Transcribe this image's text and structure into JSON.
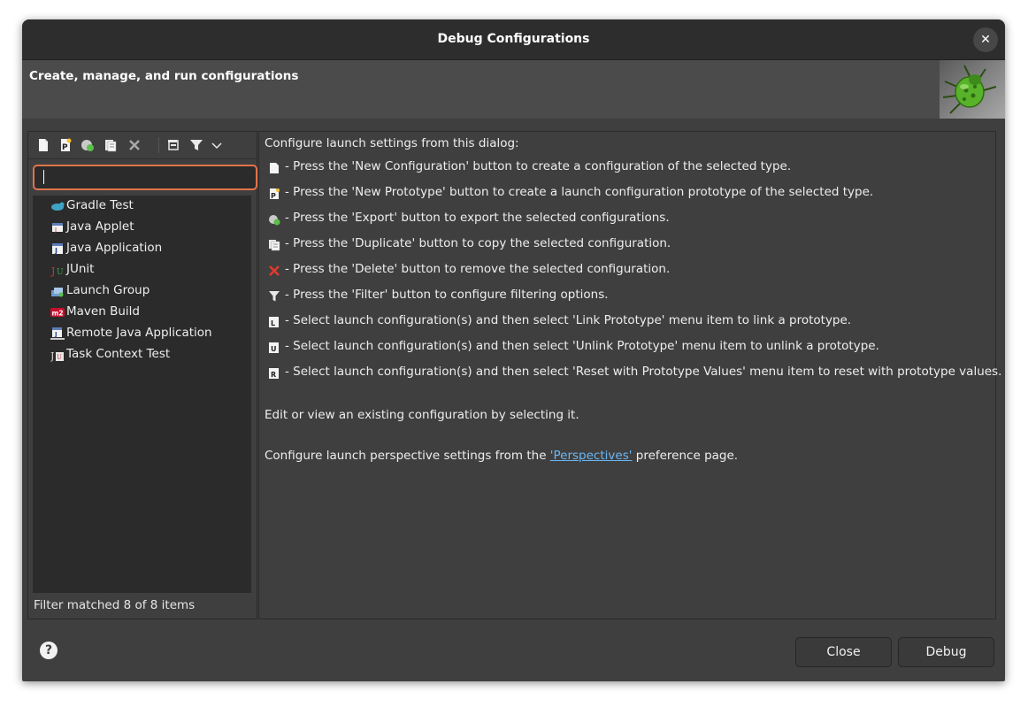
{
  "window": {
    "title": "Debug Configurations",
    "close_glyph": "✕"
  },
  "banner": {
    "text": "Create, manage, and run configurations",
    "icon": "debug-bug-icon"
  },
  "toolbar": {
    "buttons": [
      "new-configuration-icon",
      "new-prototype-icon",
      "export-icon",
      "duplicate-icon",
      "delete-icon",
      "collapse-all-icon",
      "filter-icon",
      "view-menu-chevron-icon"
    ]
  },
  "filter": {
    "value": ""
  },
  "tree": {
    "items": [
      {
        "label": "Gradle Test",
        "icon": "gradle-icon"
      },
      {
        "label": "Java Applet",
        "icon": "java-applet-icon"
      },
      {
        "label": "Java Application",
        "icon": "java-application-icon"
      },
      {
        "label": "JUnit",
        "icon": "junit-icon"
      },
      {
        "label": "Launch Group",
        "icon": "launch-group-icon"
      },
      {
        "label": "Maven Build",
        "icon": "maven-icon"
      },
      {
        "label": "Remote Java Application",
        "icon": "remote-java-icon"
      },
      {
        "label": "Task Context Test",
        "icon": "task-context-icon"
      }
    ]
  },
  "status": "Filter matched 8 of 8 items",
  "help": {
    "intro": "Configure launch settings from this dialog:",
    "lines": [
      {
        "icon": "new-configuration-icon",
        "text": "- Press the 'New Configuration' button to create a configuration of the selected type."
      },
      {
        "icon": "new-prototype-icon",
        "text": "- Press the 'New Prototype' button to create a launch configuration prototype of the selected type."
      },
      {
        "icon": "export-icon",
        "text": "- Press the 'Export' button to export the selected configurations."
      },
      {
        "icon": "duplicate-icon",
        "text": "- Press the 'Duplicate' button to copy the selected configuration."
      },
      {
        "icon": "delete-icon",
        "text": "- Press the 'Delete' button to remove the selected configuration."
      },
      {
        "icon": "filter-icon",
        "text": "- Press the 'Filter' button to configure filtering options."
      },
      {
        "icon": "link-prototype-icon",
        "text": "- Select launch configuration(s) and then select 'Link Prototype' menu item to link a prototype."
      },
      {
        "icon": "unlink-prototype-icon",
        "text": "- Select launch configuration(s) and then select 'Unlink Prototype' menu item to unlink a prototype."
      },
      {
        "icon": "reset-prototype-icon",
        "text": "- Select launch configuration(s) and then select 'Reset with Prototype Values' menu item to reset with prototype values."
      }
    ],
    "edit": "Edit or view an existing configuration by selecting it.",
    "perspective_prefix": "Configure launch perspective settings from the ",
    "perspective_link": "'Perspectives'",
    "perspective_suffix": " preference page."
  },
  "buttons": {
    "close": "Close",
    "debug": "Debug",
    "help": "?"
  }
}
